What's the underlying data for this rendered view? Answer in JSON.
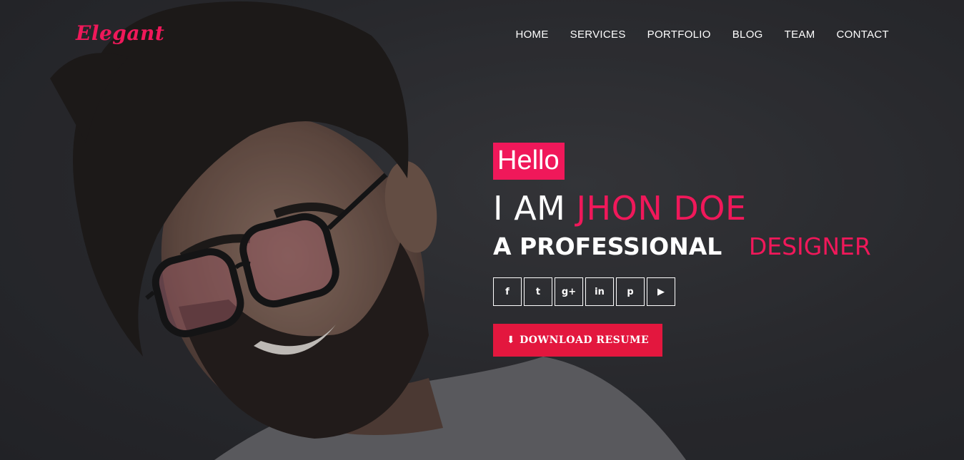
{
  "brand": {
    "logo_text": "Elegant"
  },
  "nav": {
    "items": [
      {
        "label": "HOME"
      },
      {
        "label": "SERVICES"
      },
      {
        "label": "PORTFOLIO"
      },
      {
        "label": "BLOG"
      },
      {
        "label": "TEAM"
      },
      {
        "label": "CONTACT"
      }
    ]
  },
  "hero": {
    "greeting": "Hello",
    "intro_prefix": "I AM",
    "name": "JHON DOE",
    "role_prefix": "A PROFESSIONAL",
    "role": "DESIGNER",
    "download_label": "DOWNLOAD RESUME",
    "socials": [
      {
        "icon": "facebook-icon",
        "glyph": "f"
      },
      {
        "icon": "twitter-icon",
        "glyph": "t"
      },
      {
        "icon": "google-plus-icon",
        "glyph": "g+"
      },
      {
        "icon": "linkedin-icon",
        "glyph": "in"
      },
      {
        "icon": "pinterest-icon",
        "glyph": "p"
      },
      {
        "icon": "youtube-icon",
        "glyph": "▶"
      }
    ]
  },
  "colors": {
    "accent": "#f0185a",
    "button": "#e3173e",
    "background": "#2b2c30"
  }
}
